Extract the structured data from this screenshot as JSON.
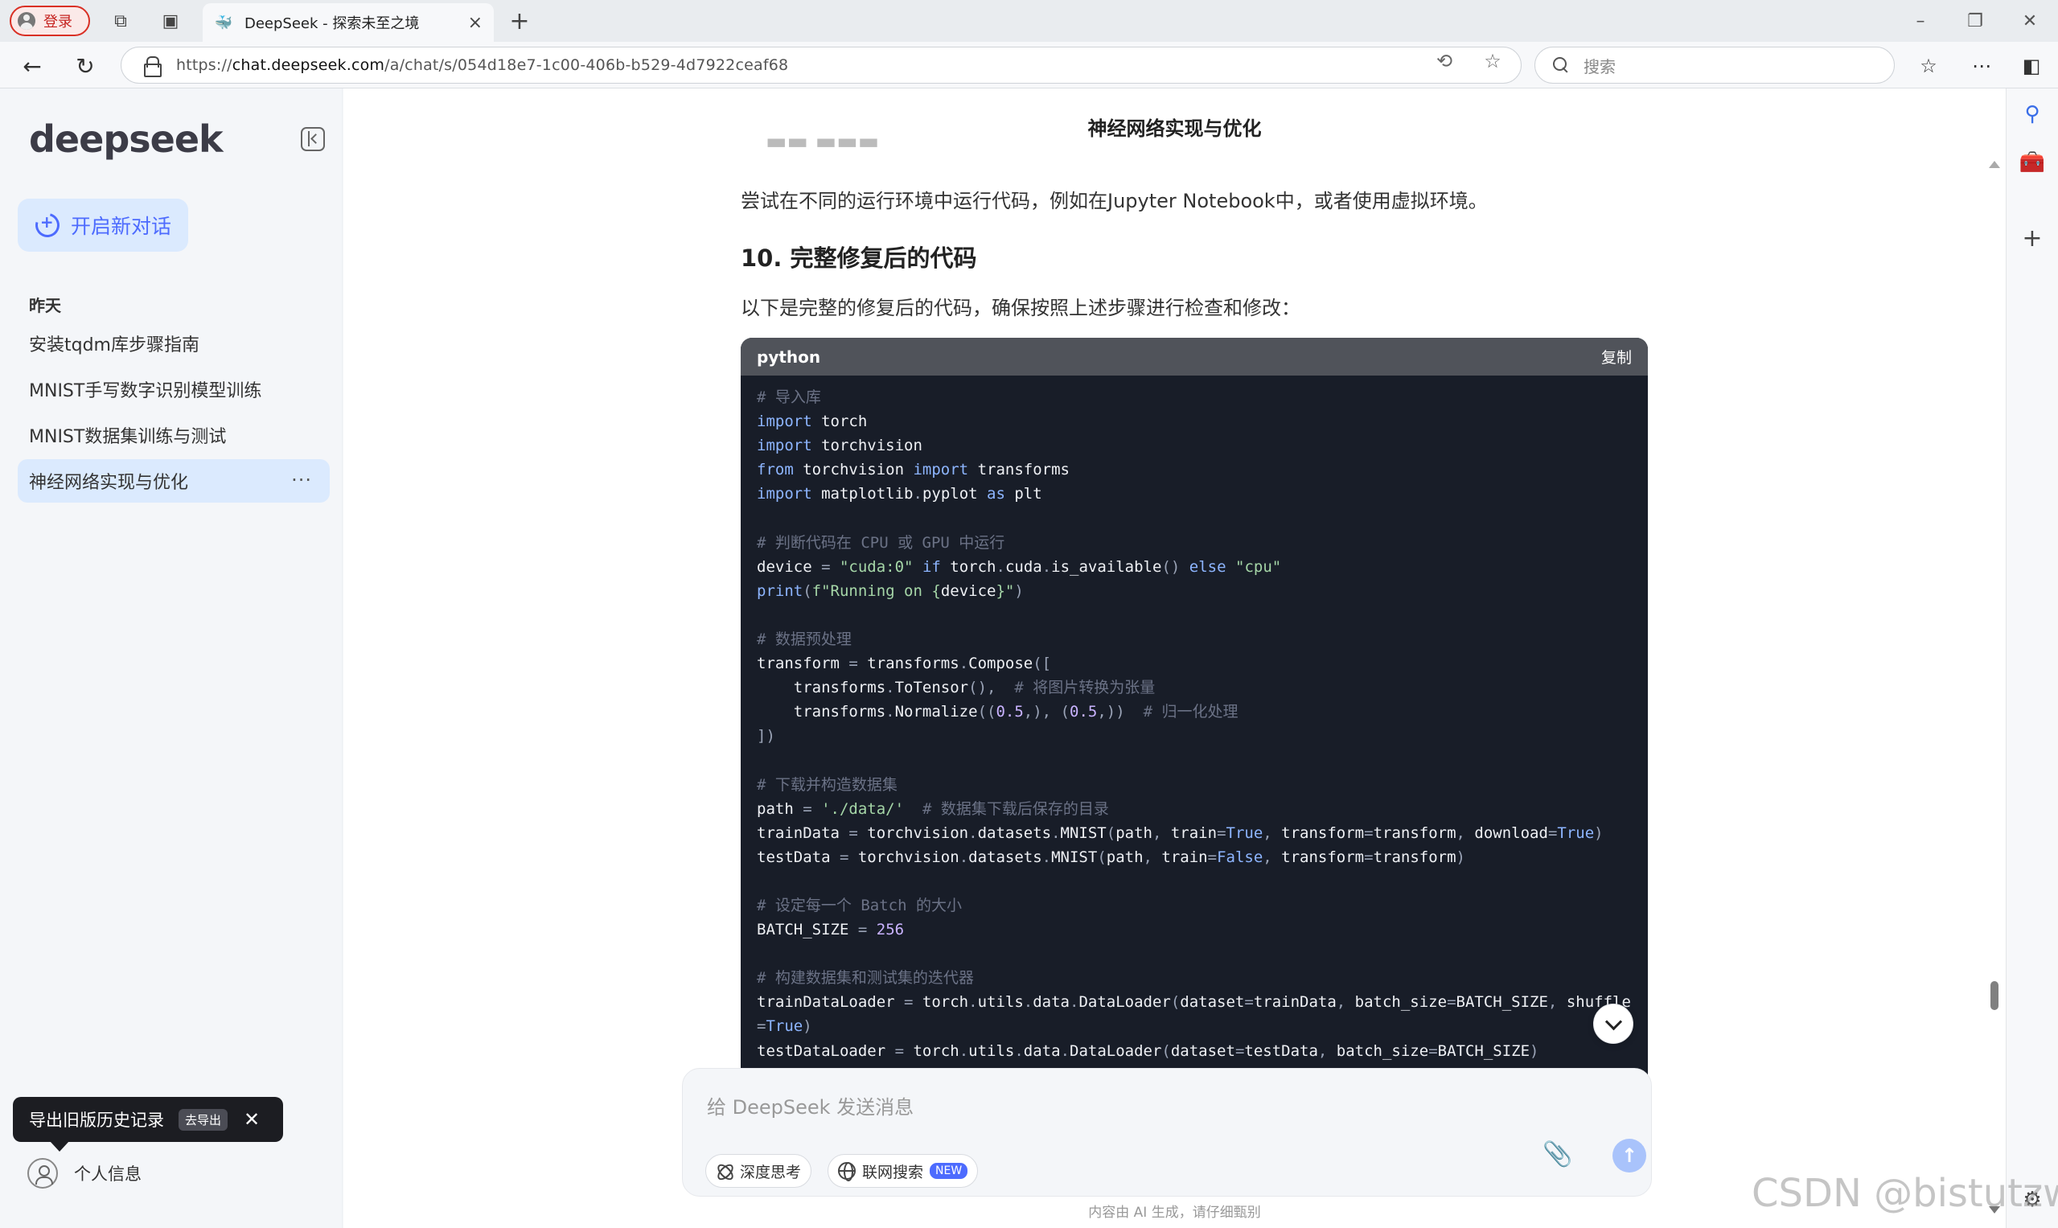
{
  "browser": {
    "login_label": "登录",
    "tab_title": "DeepSeek - 探索未至之境",
    "url_prefix": "https://",
    "url_host": "chat.deepseek.com",
    "url_path": "/a/chat/s/054d18e7-1c00-406b-b529-4d7922ceaf68",
    "search_placeholder": "搜索"
  },
  "sidebar": {
    "logo": "deepseek",
    "new_chat_label": "开启新对话",
    "group_label": "昨天",
    "items": [
      {
        "label": "安装tqdm库步骤指南"
      },
      {
        "label": "MNIST手写数字识别模型训练"
      },
      {
        "label": "MNIST数据集训练与测试"
      },
      {
        "label": "神经网络实现与优化",
        "more": "···"
      }
    ],
    "export_tip": "导出旧版历史记录",
    "export_btn": "去导出",
    "profile_label": "个人信息"
  },
  "main": {
    "title": "神经网络实现与优化",
    "para_1": "尝试在不同的运行环境中运行代码，例如在Jupyter Notebook中，或者使用虚拟环境。",
    "heading_10": "10. 完整修复后的代码",
    "para_2": "以下是完整的修复后的代码，确保按照上述步骤进行检查和修改：",
    "code_lang": "python",
    "code_copy": "复制",
    "input_placeholder": "给 DeepSeek 发送消息",
    "deep_think_label": "深度思考",
    "web_search_label": "联网搜索",
    "new_badge": "NEW",
    "footer_note": "内容由 AI 生成，请仔细甄别"
  },
  "watermark": "CSDN @bistutzw"
}
